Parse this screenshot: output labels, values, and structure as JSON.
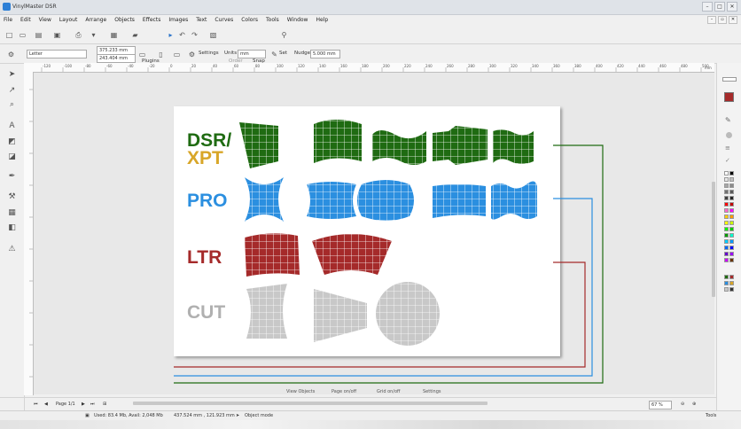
{
  "window": {
    "title": "VinylMaster DSR",
    "controls": [
      "–",
      "□",
      "✕"
    ]
  },
  "menu": [
    "File",
    "Edit",
    "View",
    "Layout",
    "Arrange",
    "Objects",
    "Effects",
    "Images",
    "Text",
    "Curves",
    "Colors",
    "Tools",
    "Window",
    "Help"
  ],
  "toolbar": {
    "plugins_label": "Plugins",
    "order_label": "Order",
    "snap_label": "Snap"
  },
  "properties": {
    "page_size": "Letter",
    "position_x": "375.233 mm",
    "position_y": "243.404 mm",
    "settings_label": "Settings",
    "units_label": "Units",
    "units_value": "mm",
    "set_label": "Set",
    "nudge_label": "Nudge",
    "nudge_value": "5.000 mm"
  },
  "ruler": {
    "h_ticks": [
      "-120",
      "-100",
      "-80",
      "-60",
      "-40",
      "-20",
      "0",
      "20",
      "40",
      "60",
      "80",
      "100",
      "120",
      "140",
      "160",
      "180",
      "200",
      "220",
      "240",
      "260",
      "280",
      "300",
      "320",
      "340",
      "360",
      "380",
      "400",
      "420",
      "440",
      "460",
      "480",
      "500"
    ],
    "unit": "mm"
  },
  "canvas_labels": {
    "dsr": "DSR/",
    "xpt": "XPT",
    "pro": "PRO",
    "ltr": "LTR",
    "cut": "CUT"
  },
  "colors": {
    "dsr_green": "#1f6b12",
    "xpt_gold": "#d8a628",
    "pro_blue": "#2b8fe0",
    "ltr_red": "#a52a2a",
    "cut_gray": "#c8c8c8"
  },
  "hints": {
    "view_objects": "View Objects",
    "page_onoff": "Page on/off",
    "grid_onoff": "Grid on/off",
    "settings": "Settings"
  },
  "page_nav": {
    "label": "Page 1/1"
  },
  "zoom": {
    "value": "67 %"
  },
  "status": {
    "memory": "Used: 83.4 Mb, Avail: 2,048 Mb",
    "coords": "437.524 mm , 121.923 mm",
    "mode": "Object mode",
    "tools_label": "Tools"
  },
  "right_panel": {
    "tools_label": "Tools"
  }
}
